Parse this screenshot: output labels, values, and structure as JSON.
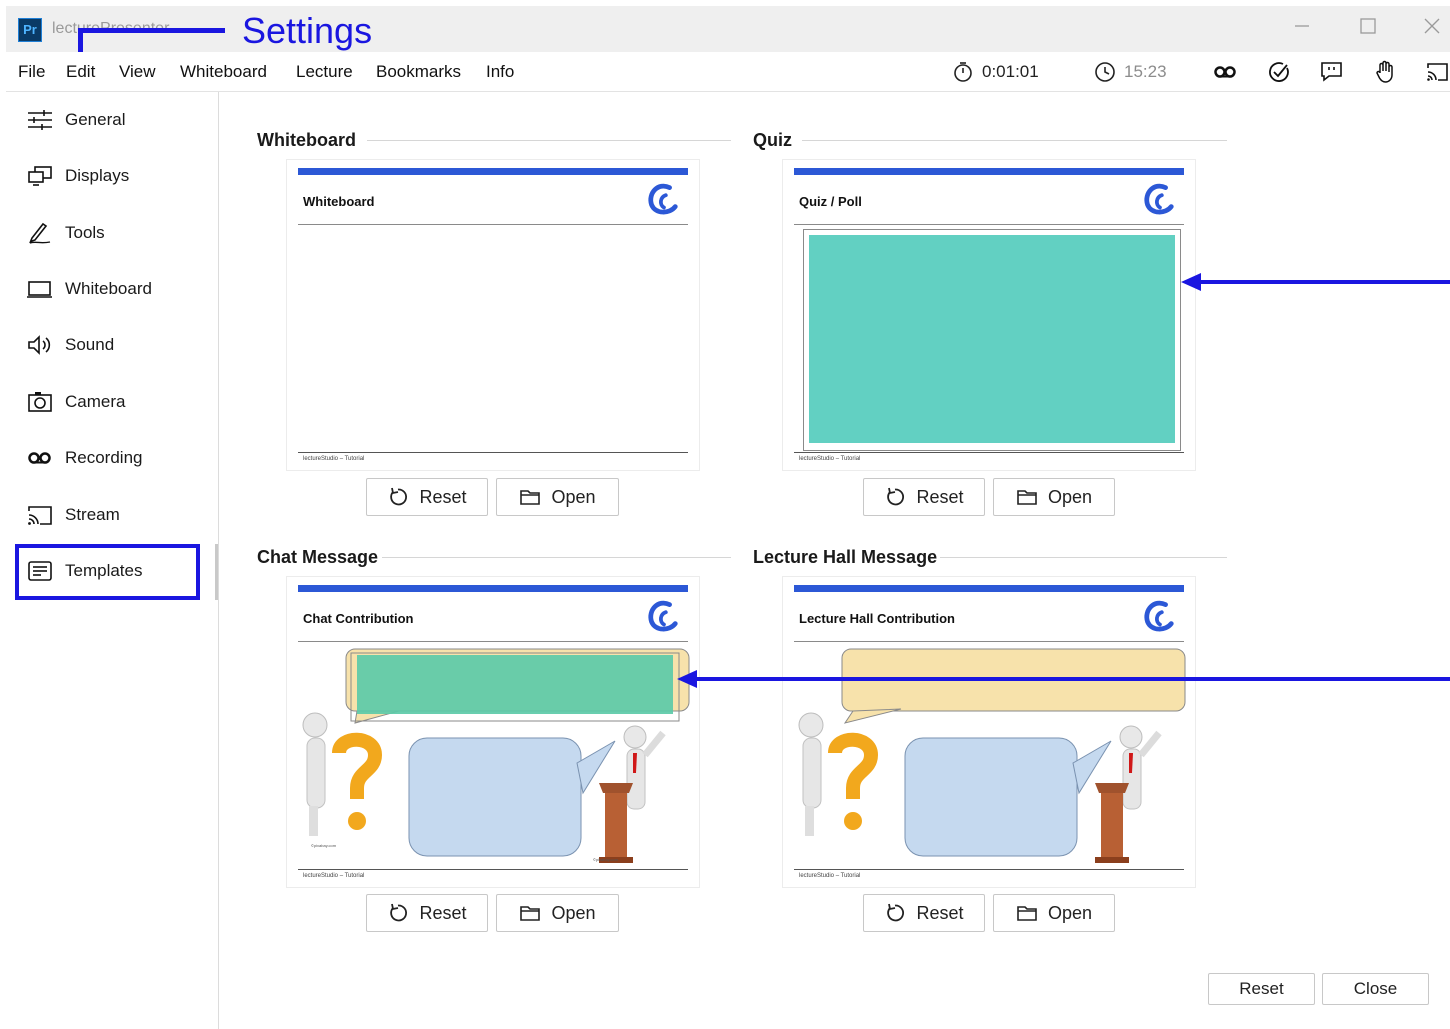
{
  "window": {
    "title": "lecturePresenter",
    "app_icon_text": "Pr",
    "controls": [
      "minimize-icon",
      "maximize-icon",
      "close-icon"
    ]
  },
  "annotation": {
    "settings_label": "Settings",
    "color": "#1a16e0"
  },
  "menu": {
    "items": [
      "File",
      "Edit",
      "View",
      "Whiteboard",
      "Lecture",
      "Bookmarks",
      "Info"
    ]
  },
  "status": {
    "stopwatch": "0:01:01",
    "clock": "15:23"
  },
  "toolbar_icons": [
    "recording-icon",
    "quiz-check-icon",
    "chat-icon",
    "hand-icon",
    "stream-icon"
  ],
  "sidebar": {
    "items": [
      {
        "label": "General",
        "icon": "sliders-icon"
      },
      {
        "label": "Displays",
        "icon": "displays-icon"
      },
      {
        "label": "Tools",
        "icon": "pen-icon"
      },
      {
        "label": "Whiteboard",
        "icon": "whiteboard-icon"
      },
      {
        "label": "Sound",
        "icon": "speaker-icon"
      },
      {
        "label": "Camera",
        "icon": "camera-icon"
      },
      {
        "label": "Recording",
        "icon": "recording-icon"
      },
      {
        "label": "Stream",
        "icon": "cast-icon"
      },
      {
        "label": "Templates",
        "icon": "template-icon"
      }
    ],
    "selected": "Templates"
  },
  "sections": [
    {
      "title": "Whiteboard",
      "card_title": "Whiteboard",
      "footer": "lectureStudio – Tutorial"
    },
    {
      "title": "Quiz",
      "card_title": "Quiz / Poll",
      "footer": "lectureStudio – Tutorial"
    },
    {
      "title": "Chat Message",
      "card_title": "Chat Contribution",
      "footer": "lectureStudio – Tutorial",
      "credit": "©pixabay.com"
    },
    {
      "title": "Lecture Hall Message",
      "card_title": "Lecture Hall Contribution",
      "footer": "lectureStudio – Tutorial"
    }
  ],
  "buttons": {
    "reset": "Reset",
    "open": "Open",
    "close": "Close"
  },
  "colors": {
    "accent_blue": "#2c58d6",
    "quiz_fill": "#62d0c2",
    "chat_fill": "#5ccaa8",
    "lecture_bubble": "#f7e2ab",
    "student_bubble": "#c5d9ef",
    "annotation": "#1a16e0"
  }
}
